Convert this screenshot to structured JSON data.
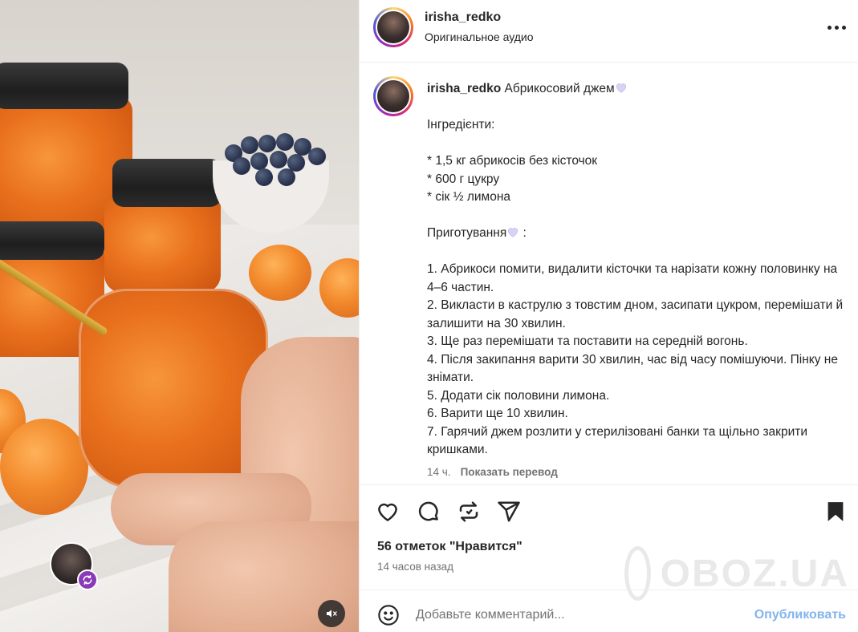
{
  "post": {
    "username": "irisha_redko",
    "audio": "Оригинальное аудио",
    "caption_title": "Абрикосовий джем",
    "caption_lines": [
      "Інгредієнти:",
      "",
      "* 1,5 кг абрикосів без кісточок",
      "* 600 г цукру",
      "* сік ½ лимона",
      "",
      "Приготування",
      "",
      "1. Абрикоси помити, видалити кісточки та нарізати кожну половинку на 4–6 частин.",
      "2. Викласти в каструлю з товстим дном, засипати цукром, перемішати й залишити на 30 хвилин.",
      "3. Ще раз перемішати та поставити на середній вогонь.",
      "4. Після закипання варити 30 хвилин, час від часу помішуючи. Пінку не знімати.",
      "5. Додати сік половини лимона.",
      "6. Варити ще 10 хвилин.",
      "7. Гарячий джем розлити у стерилізовані банки та щільно закрити кришками."
    ],
    "age": "14 ч.",
    "translate_label": "Показать перевод",
    "likes": "56 отметок \"Нравится\"",
    "posted": "14 часов назад"
  },
  "comment": {
    "placeholder": "Добавьте комментарий...",
    "publish_label": "Опубликовать"
  },
  "watermark": "OBOZ.UA",
  "icons": {
    "like": "heart-icon",
    "comment": "comment-icon",
    "repost": "repost-icon",
    "share": "share-icon",
    "save": "bookmark-icon",
    "more": "more-icon",
    "mute": "muted-speaker-icon",
    "emoji": "emoji-icon"
  },
  "colors": {
    "accent": "#0095f6",
    "publish_disabled": "#82b4ed",
    "heart_emoji": "#c7bff0"
  }
}
